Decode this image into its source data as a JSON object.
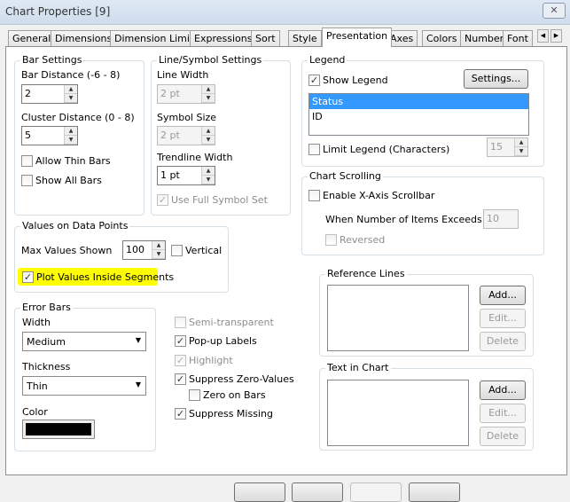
{
  "window": {
    "title": "Chart Properties [9]"
  },
  "tabs": [
    "General",
    "Dimensions",
    "Dimension Limits",
    "Expressions",
    "Sort",
    "Style",
    "Presentation",
    "Axes",
    "Colors",
    "Number",
    "Font"
  ],
  "active_tab": "Presentation",
  "bar_settings": {
    "title": "Bar Settings",
    "bar_distance_label": "Bar Distance (-6 - 8)",
    "bar_distance": "2",
    "cluster_distance_label": "Cluster Distance (0 - 8)",
    "cluster_distance": "5",
    "allow_thin_bars": "Allow Thin Bars",
    "allow_thin_bars_checked": false,
    "show_all_bars": "Show All Bars",
    "show_all_bars_checked": false
  },
  "line_symbol": {
    "title": "Line/Symbol Settings",
    "line_width_label": "Line Width",
    "line_width": "2 pt",
    "symbol_size_label": "Symbol Size",
    "symbol_size": "2 pt",
    "trendline_width_label": "Trendline Width",
    "trendline_width": "1 pt",
    "use_full_symbol_set": "Use Full Symbol Set",
    "use_full_symbol_set_checked": true
  },
  "legend": {
    "title": "Legend",
    "show_legend": "Show Legend",
    "show_legend_checked": true,
    "settings": "Settings...",
    "items": [
      "Status",
      "ID"
    ],
    "selected": "Status",
    "limit_legend": "Limit Legend (Characters)",
    "limit_legend_checked": false,
    "limit_value": "15"
  },
  "chart_scrolling": {
    "title": "Chart Scrolling",
    "enable": "Enable X-Axis Scrollbar",
    "enable_checked": false,
    "when_label": "When Number of Items Exceeds:",
    "when_value": "10",
    "reversed": "Reversed",
    "reversed_checked": false
  },
  "values_on_points": {
    "title": "Values on Data Points",
    "max_label": "Max Values Shown",
    "max_value": "100",
    "vertical": "Vertical",
    "vertical_checked": false,
    "plot_inside": "Plot Values Inside Segments",
    "plot_inside_checked": true,
    "highlight_color": "#ffff00"
  },
  "error_bars": {
    "title": "Error Bars",
    "width_label": "Width",
    "width_value": "Medium",
    "thickness_label": "Thickness",
    "thickness_value": "Thin",
    "color_label": "Color",
    "color": "#000000"
  },
  "options": [
    {
      "label": "Semi-transparent",
      "checked": false,
      "disabled": true
    },
    {
      "label": "Pop-up Labels",
      "checked": true,
      "disabled": false
    },
    {
      "label": "Highlight",
      "checked": true,
      "disabled": true
    },
    {
      "label": "Suppress Zero-Values",
      "checked": true,
      "disabled": false
    },
    {
      "label": "Zero on Bars",
      "checked": false,
      "disabled": false
    },
    {
      "label": "Suppress Missing",
      "checked": true,
      "disabled": false
    }
  ],
  "reference_lines": {
    "title": "Reference Lines",
    "add": "Add...",
    "edit": "Edit...",
    "delete": "Delete"
  },
  "text_in_chart": {
    "title": "Text in Chart",
    "add": "Add...",
    "edit": "Edit...",
    "delete": "Delete"
  }
}
